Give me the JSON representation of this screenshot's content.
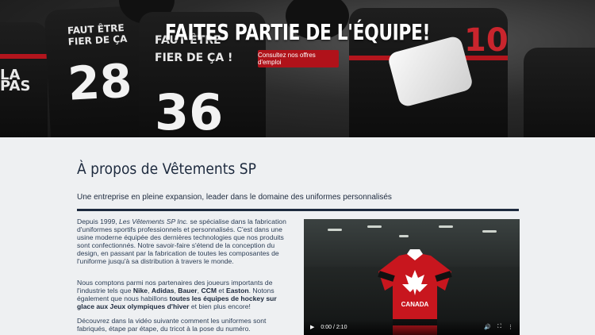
{
  "hero": {
    "title": "FAITES PARTIE DE L'ÉQUIPE!",
    "button_label": "Consultez nos offres d'emploi",
    "jersey_texts": [
      "FAUT ÊTRE FIER DE ÇA",
      "FAUT ÊTRE FIER DE ÇA !",
      "LA PAS"
    ],
    "jersey_numbers": [
      "28",
      "36",
      "10"
    ]
  },
  "about": {
    "title": "À propos de Vêtements SP",
    "subtitle": "Une entreprise en pleine expansion, leader dans le domaine des uniformes personnalisés",
    "p1": {
      "a": "Depuis 1999, ",
      "company": "Les Vêtements SP Inc.",
      "b": " se spécialise dans la fabrication d'uniformes sportifs professionnels et personnalisés. C'est dans une usine moderne équipée des dernières technologies que nos produits sont confectionnés. Notre savoir-faire s'étend de la conception du design, en passant par la fabrication de toutes les composantes de l'uniforme jusqu'à sa distribution à travers le monde."
    },
    "p2": {
      "a": "Nous comptons parmi nos partenaires des joueurs importants de l'industrie tels que ",
      "nike": "Nike",
      "s1": ", ",
      "adidas": "Adidas",
      "s2": ", ",
      "bauer": "Bauer",
      "s3": ", ",
      "ccm": "CCM",
      "s4": " et ",
      "easton": "Easton",
      "b": ". Notons également que nous habillons ",
      "teams": "toutes les équipes de hockey sur glace aux Jeux olympiques d'hiver",
      "c": " et bien plus encore!"
    },
    "p3": "Découvrez dans la vidéo suivante comment les uniformes sont fabriqués, étape par étape, du tricot à la pose du numéro."
  },
  "video": {
    "time": "0:00 / 2:10",
    "jersey_text": "CANADA",
    "icons": [
      "play-icon",
      "volume-icon",
      "fullscreen-icon",
      "more-options-icon"
    ]
  },
  "colors": {
    "brand_red": "#b0121a",
    "navy": "#1d2a3e"
  }
}
